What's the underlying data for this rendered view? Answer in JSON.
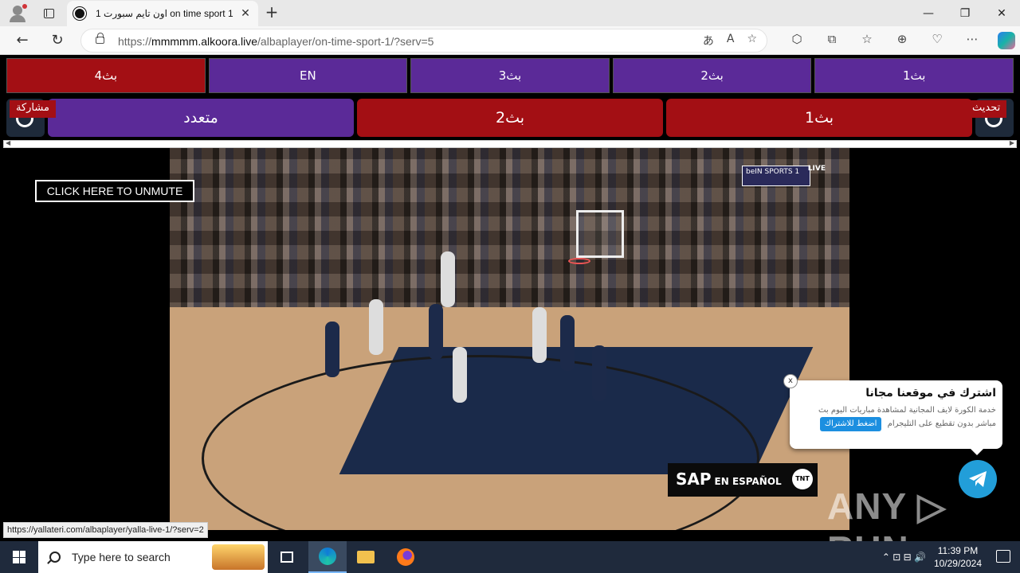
{
  "browser": {
    "tab_title": "اون تايم سبورت 1 on time sport 1",
    "tab_close": "✕",
    "new_tab": "+",
    "url_prefix": "https://",
    "url_host": "mmmmm.alkoora.live",
    "url_path": "/albaplayer/on-time-sport-1/?serv=5",
    "status_url": "https://yallateri.com/albaplayer/yalla-live-1/?serv=2",
    "window_controls": {
      "minimize": "—",
      "maximize": "❐",
      "close": "✕"
    },
    "nav": {
      "back": "←",
      "reload": "↻"
    },
    "url_icons": [
      "あ",
      "A",
      "☆"
    ],
    "toolbar_icons": [
      "⬡",
      "⧉",
      "☆",
      "⊕",
      "♡",
      "⋯"
    ]
  },
  "server_tabs": [
    {
      "label": "بث4",
      "color": "red"
    },
    {
      "label": "EN",
      "color": "purple"
    },
    {
      "label": "بث3",
      "color": "purple"
    },
    {
      "label": "بث2",
      "color": "purple"
    },
    {
      "label": "بث1",
      "color": "purple"
    }
  ],
  "link_buttons": [
    {
      "label": "متعدد",
      "color": "#5b2a98"
    },
    {
      "label": "بث2",
      "color": "#a30f14"
    },
    {
      "label": "بث1",
      "color": "#a30f14"
    }
  ],
  "share_label": "مشاركة",
  "refresh_label": "تحديث",
  "video": {
    "unmute_label": "CLICK HERE TO UNMUTE",
    "channel_logo": "beIN SPORTS 1",
    "live_label": "LIVE",
    "sap_main": "SAP",
    "sap_sub": "EN ESPAÑOL",
    "tnt_label": "TNT"
  },
  "popup": {
    "title": "اشترك في موقعنا مجانا",
    "text": "خدمة الكورة لايف المجانية لمشاهدة مباريات اليوم بث مباشر بدون تقطيع على التليجرام",
    "button": "اضغط للاشتراك",
    "close": "x"
  },
  "watermark": "ANY ▷ RUN",
  "taskbar": {
    "search_placeholder": "Type here to search",
    "time": "11:39 PM",
    "date": "10/29/2024",
    "tray_icons": "⌃  ⊡  ⊟  🔊"
  }
}
